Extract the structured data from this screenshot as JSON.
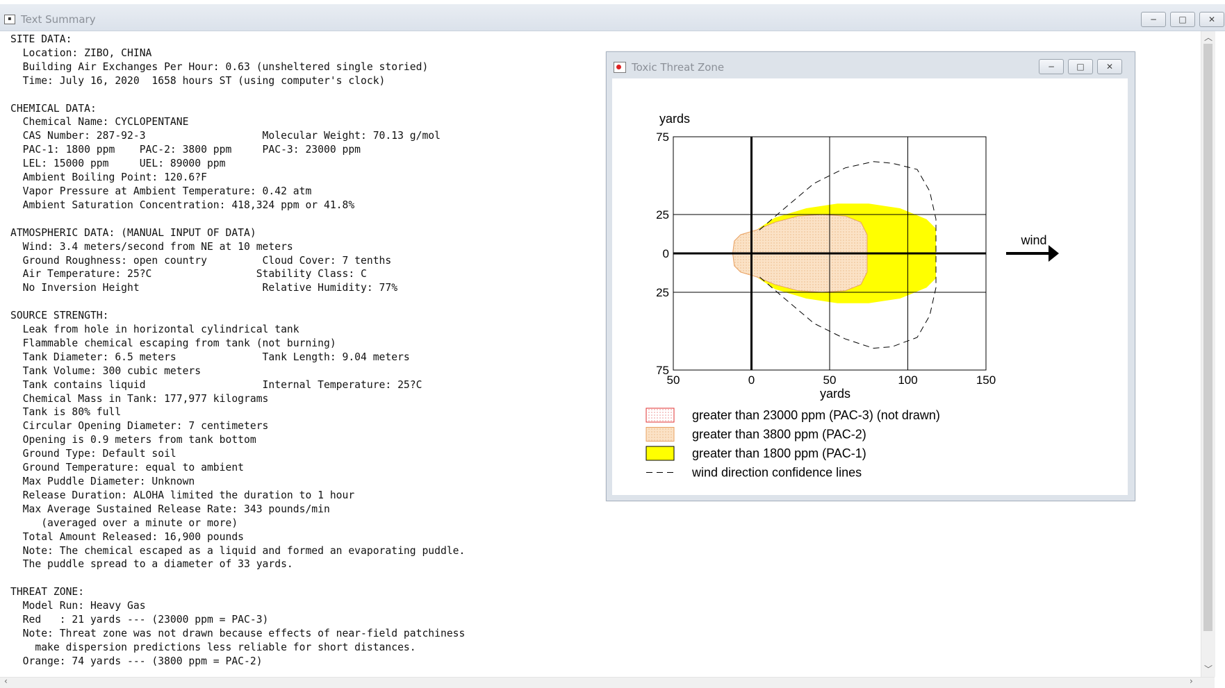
{
  "main_window": {
    "title": "Text Summary",
    "minimize": "−",
    "maximize": "□",
    "close": "✕",
    "lines": [
      "SITE DATA:",
      "  Location: ZIBO, CHINA",
      "  Building Air Exchanges Per Hour: 0.63 (unsheltered single storied)",
      "  Time: July 16, 2020  1658 hours ST (using computer's clock)",
      "",
      "CHEMICAL DATA:",
      "  Chemical Name: CYCLOPENTANE",
      "  CAS Number: 287-92-3                   Molecular Weight: 70.13 g/mol",
      "  PAC-1: 1800 ppm    PAC-2: 3800 ppm     PAC-3: 23000 ppm",
      "  LEL: 15000 ppm     UEL: 89000 ppm",
      "  Ambient Boiling Point: 120.6?F",
      "  Vapor Pressure at Ambient Temperature: 0.42 atm",
      "  Ambient Saturation Concentration: 418,324 ppm or 41.8%",
      "",
      "ATMOSPHERIC DATA: (MANUAL INPUT OF DATA)",
      "  Wind: 3.4 meters/second from NE at 10 meters",
      "  Ground Roughness: open country         Cloud Cover: 7 tenths",
      "  Air Temperature: 25?C                 Stability Class: C",
      "  No Inversion Height                    Relative Humidity: 77%",
      "",
      "SOURCE STRENGTH:",
      "  Leak from hole in horizontal cylindrical tank",
      "  Flammable chemical escaping from tank (not burning)",
      "  Tank Diameter: 6.5 meters              Tank Length: 9.04 meters",
      "  Tank Volume: 300 cubic meters",
      "  Tank contains liquid                   Internal Temperature: 25?C",
      "  Chemical Mass in Tank: 177,977 kilograms",
      "  Tank is 80% full",
      "  Circular Opening Diameter: 7 centimeters",
      "  Opening is 0.9 meters from tank bottom",
      "  Ground Type: Default soil",
      "  Ground Temperature: equal to ambient",
      "  Max Puddle Diameter: Unknown",
      "  Release Duration: ALOHA limited the duration to 1 hour",
      "  Max Average Sustained Release Rate: 343 pounds/min",
      "     (averaged over a minute or more)",
      "  Total Amount Released: 16,900 pounds",
      "  Note: The chemical escaped as a liquid and formed an evaporating puddle.",
      "  The puddle spread to a diameter of 33 yards.",
      "",
      "THREAT ZONE:",
      "  Model Run: Heavy Gas",
      "  Red   : 21 yards --- (23000 ppm = PAC-3)",
      "  Note: Threat zone was not drawn because effects of near-field patchiness",
      "    make dispersion predictions less reliable for short distances.",
      "  Orange: 74 yards --- (3800 ppm = PAC-2)"
    ]
  },
  "toxic_window": {
    "title": "Toxic Threat Zone",
    "minimize": "−",
    "maximize": "□",
    "close": "✕"
  },
  "chart_data": {
    "type": "area",
    "ylabel": "yards",
    "xlabel": "yards",
    "x_ticks": [
      "50",
      "0",
      "50",
      "100",
      "150"
    ],
    "y_ticks": [
      "75",
      "25",
      "0",
      "25",
      "75"
    ],
    "xlim": [
      -50,
      150
    ],
    "ylim": [
      -75,
      75
    ],
    "grid": true,
    "wind_label": "wind",
    "wind_direction": "right",
    "colors": {
      "pac3": "#e03030",
      "pac2": "#f8d2a6",
      "pac2_edge": "#e8a060",
      "pac1": "#ffff00",
      "confidence": "#000000"
    },
    "zones": [
      {
        "name": "PAC-1",
        "outline": [
          [
            -12,
            0
          ],
          [
            -11,
            8
          ],
          [
            -7,
            12
          ],
          [
            3,
            15
          ],
          [
            15,
            23
          ],
          [
            35,
            29
          ],
          [
            55,
            32
          ],
          [
            75,
            32
          ],
          [
            95,
            29
          ],
          [
            112,
            22
          ],
          [
            118,
            16
          ],
          [
            118,
            -16
          ],
          [
            112,
            -22
          ],
          [
            95,
            -29
          ],
          [
            75,
            -32
          ],
          [
            55,
            -32
          ],
          [
            35,
            -29
          ],
          [
            15,
            -23
          ],
          [
            3,
            -15
          ],
          [
            -7,
            -12
          ],
          [
            -11,
            -8
          ]
        ]
      },
      {
        "name": "PAC-2",
        "outline": [
          [
            -12,
            0
          ],
          [
            -11,
            8
          ],
          [
            -7,
            12
          ],
          [
            3,
            15
          ],
          [
            15,
            20
          ],
          [
            30,
            24
          ],
          [
            45,
            25
          ],
          [
            60,
            24
          ],
          [
            70,
            20
          ],
          [
            74,
            12
          ],
          [
            74,
            -12
          ],
          [
            70,
            -20
          ],
          [
            60,
            -24
          ],
          [
            45,
            -25
          ],
          [
            30,
            -24
          ],
          [
            15,
            -20
          ],
          [
            3,
            -15
          ],
          [
            -7,
            -12
          ],
          [
            -11,
            -8
          ]
        ]
      }
    ],
    "confidence_lines": [
      [
        [
          5,
          15
        ],
        [
          20,
          28
        ],
        [
          40,
          45
        ],
        [
          60,
          55
        ],
        [
          78,
          59
        ],
        [
          90,
          58
        ],
        [
          106,
          54
        ],
        [
          114,
          40
        ],
        [
          118,
          22
        ],
        [
          118,
          -22
        ],
        [
          114,
          -40
        ],
        [
          106,
          -54
        ],
        [
          90,
          -60
        ],
        [
          78,
          -61
        ],
        [
          60,
          -55
        ],
        [
          40,
          -45
        ],
        [
          20,
          -28
        ],
        [
          5,
          -15
        ]
      ]
    ],
    "legend": [
      {
        "label": "greater than 23000 ppm (PAC-3) (not drawn)",
        "style": "pac3"
      },
      {
        "label": "greater than 3800 ppm (PAC-2)",
        "style": "pac2"
      },
      {
        "label": "greater than 1800 ppm (PAC-1)",
        "style": "pac1"
      },
      {
        "label": "wind direction confidence lines",
        "style": "dash"
      }
    ]
  }
}
